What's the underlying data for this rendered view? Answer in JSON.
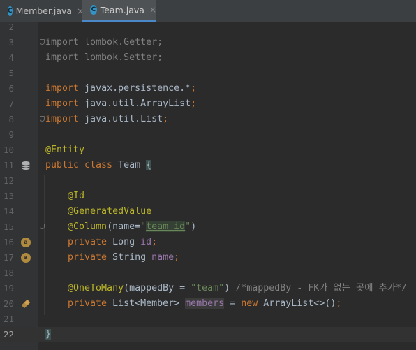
{
  "tabs": [
    {
      "name": "Member.java",
      "icon": "C",
      "active": false,
      "close": "×"
    },
    {
      "name": "Team.java",
      "icon": "C",
      "active": true,
      "close": "×"
    }
  ],
  "lines": [
    {
      "n": "2"
    },
    {
      "n": "3",
      "t": [
        "import lombok.Getter;"
      ]
    },
    {
      "n": "4",
      "t": [
        "import lombok.Setter;"
      ]
    },
    {
      "n": "5"
    },
    {
      "n": "6",
      "t": [
        "import",
        " javax.persistence.*",
        ";"
      ]
    },
    {
      "n": "7",
      "t": [
        "import",
        " java.util.ArrayList",
        ";"
      ]
    },
    {
      "n": "8",
      "t": [
        "import",
        " java.util.List",
        ";"
      ]
    },
    {
      "n": "9"
    },
    {
      "n": "10",
      "t": [
        "@Entity"
      ]
    },
    {
      "n": "11",
      "t": [
        "public class",
        " Team ",
        "{"
      ]
    },
    {
      "n": "12"
    },
    {
      "n": "13",
      "t": [
        "    @Id"
      ]
    },
    {
      "n": "14",
      "t": [
        "    @GeneratedValue"
      ]
    },
    {
      "n": "15",
      "t": [
        "    @Column",
        "(name=",
        "\"",
        "team_id",
        "\"",
        ")"
      ]
    },
    {
      "n": "16",
      "t": [
        "    private",
        " Long ",
        "id",
        ";"
      ]
    },
    {
      "n": "17",
      "t": [
        "    private",
        " String ",
        "name",
        ";"
      ]
    },
    {
      "n": "18"
    },
    {
      "n": "19",
      "t": [
        "    @OneToMany",
        "(mappedBy = ",
        "\"team\"",
        ") ",
        "/*mappedBy - FK가 없는 곳에 추가*/"
      ]
    },
    {
      "n": "20",
      "t": [
        "    private",
        " List<Member> ",
        "members",
        " = ",
        "new",
        " ArrayList<>()",
        ";"
      ]
    },
    {
      "n": "21"
    },
    {
      "n": "22",
      "t": [
        "}"
      ]
    }
  ],
  "gutter_icons": {
    "l11": "entity-icon",
    "l16": "a",
    "l17": "a",
    "l20": "relation-icon"
  }
}
